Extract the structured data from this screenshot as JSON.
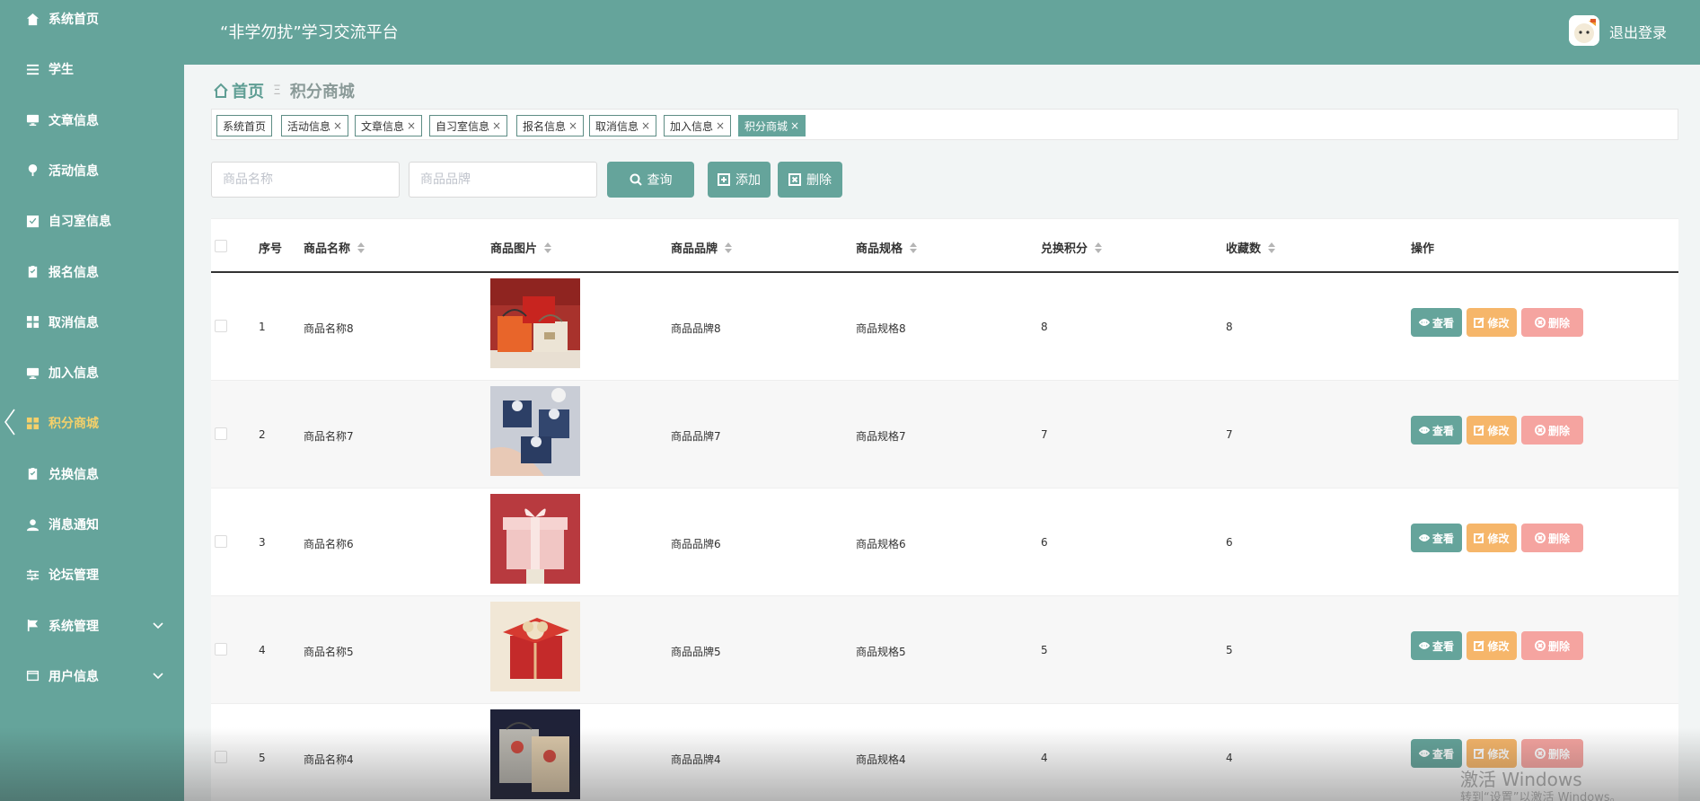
{
  "header": {
    "title": "“非学勿扰”学习交流平台",
    "logout_label": "退出登录"
  },
  "sidebar": {
    "items": [
      {
        "label": "系统首页",
        "icon": "home-icon"
      },
      {
        "label": "学生",
        "icon": "list-icon"
      },
      {
        "label": "文章信息",
        "icon": "monitor-icon"
      },
      {
        "label": "活动信息",
        "icon": "pin-icon"
      },
      {
        "label": "自习室信息",
        "icon": "checkbox-icon"
      },
      {
        "label": "报名信息",
        "icon": "clipboard-icon"
      },
      {
        "label": "取消信息",
        "icon": "grid-icon"
      },
      {
        "label": "加入信息",
        "icon": "monitor-icon"
      },
      {
        "label": "积分商城",
        "icon": "grid-icon",
        "active": true
      },
      {
        "label": "兑换信息",
        "icon": "clipboard-icon"
      },
      {
        "label": "消息通知",
        "icon": "user-icon"
      },
      {
        "label": "论坛管理",
        "icon": "sliders-icon"
      },
      {
        "label": "系统管理",
        "icon": "flag-icon",
        "expandable": true
      },
      {
        "label": "用户信息",
        "icon": "card-icon",
        "expandable": true
      }
    ]
  },
  "breadcrumb": {
    "home": "首页",
    "separator": "Ξ",
    "current": "积分商城"
  },
  "tags": [
    {
      "label": "系统首页",
      "closable": false
    },
    {
      "label": "活动信息",
      "closable": true
    },
    {
      "label": "文章信息",
      "closable": true
    },
    {
      "label": "自习室信息",
      "closable": true
    },
    {
      "label": "报名信息",
      "closable": true
    },
    {
      "label": "取消信息",
      "closable": true
    },
    {
      "label": "加入信息",
      "closable": true
    },
    {
      "label": "积分商城",
      "closable": true,
      "active": true
    }
  ],
  "tag_close_glyph": "×",
  "search": {
    "name_placeholder": "商品名称",
    "brand_placeholder": "商品品牌",
    "query_label": "查询",
    "add_label": "添加",
    "delete_label": "删除"
  },
  "table": {
    "columns": [
      "序号",
      "商品名称",
      "商品图片",
      "商品品牌",
      "商品规格",
      "兑换积分",
      "收藏数",
      "操作"
    ],
    "rows": [
      {
        "index": "1",
        "name": "商品名称8",
        "brand": "商品品牌8",
        "spec": "商品规格8",
        "points": "8",
        "favorites": "8",
        "image": "gift-bags-red"
      },
      {
        "index": "2",
        "name": "商品名称7",
        "brand": "商品品牌7",
        "spec": "商品规格7",
        "points": "7",
        "favorites": "7",
        "image": "gift-boxes-blue"
      },
      {
        "index": "3",
        "name": "商品名称6",
        "brand": "商品品牌6",
        "spec": "商品规格6",
        "points": "6",
        "favorites": "6",
        "image": "gift-box-pink"
      },
      {
        "index": "4",
        "name": "商品名称5",
        "brand": "商品品牌5",
        "spec": "商品规格5",
        "points": "5",
        "favorites": "5",
        "image": "gift-box-red"
      },
      {
        "index": "5",
        "name": "商品名称4",
        "brand": "商品品牌4",
        "spec": "商品规格4",
        "points": "4",
        "favorites": "4",
        "image": "gift-bag-dark"
      }
    ],
    "actions": {
      "view": "查看",
      "edit": "修改",
      "delete": "删除"
    }
  },
  "watermark": {
    "line1": "激活 Windows",
    "line2": "转到“设置”以激活 Windows。"
  },
  "colors": {
    "primary": "#65a49b",
    "active_menu": "#f4d06a",
    "edit": "#f6b66a",
    "delete": "#f5a4a0"
  }
}
